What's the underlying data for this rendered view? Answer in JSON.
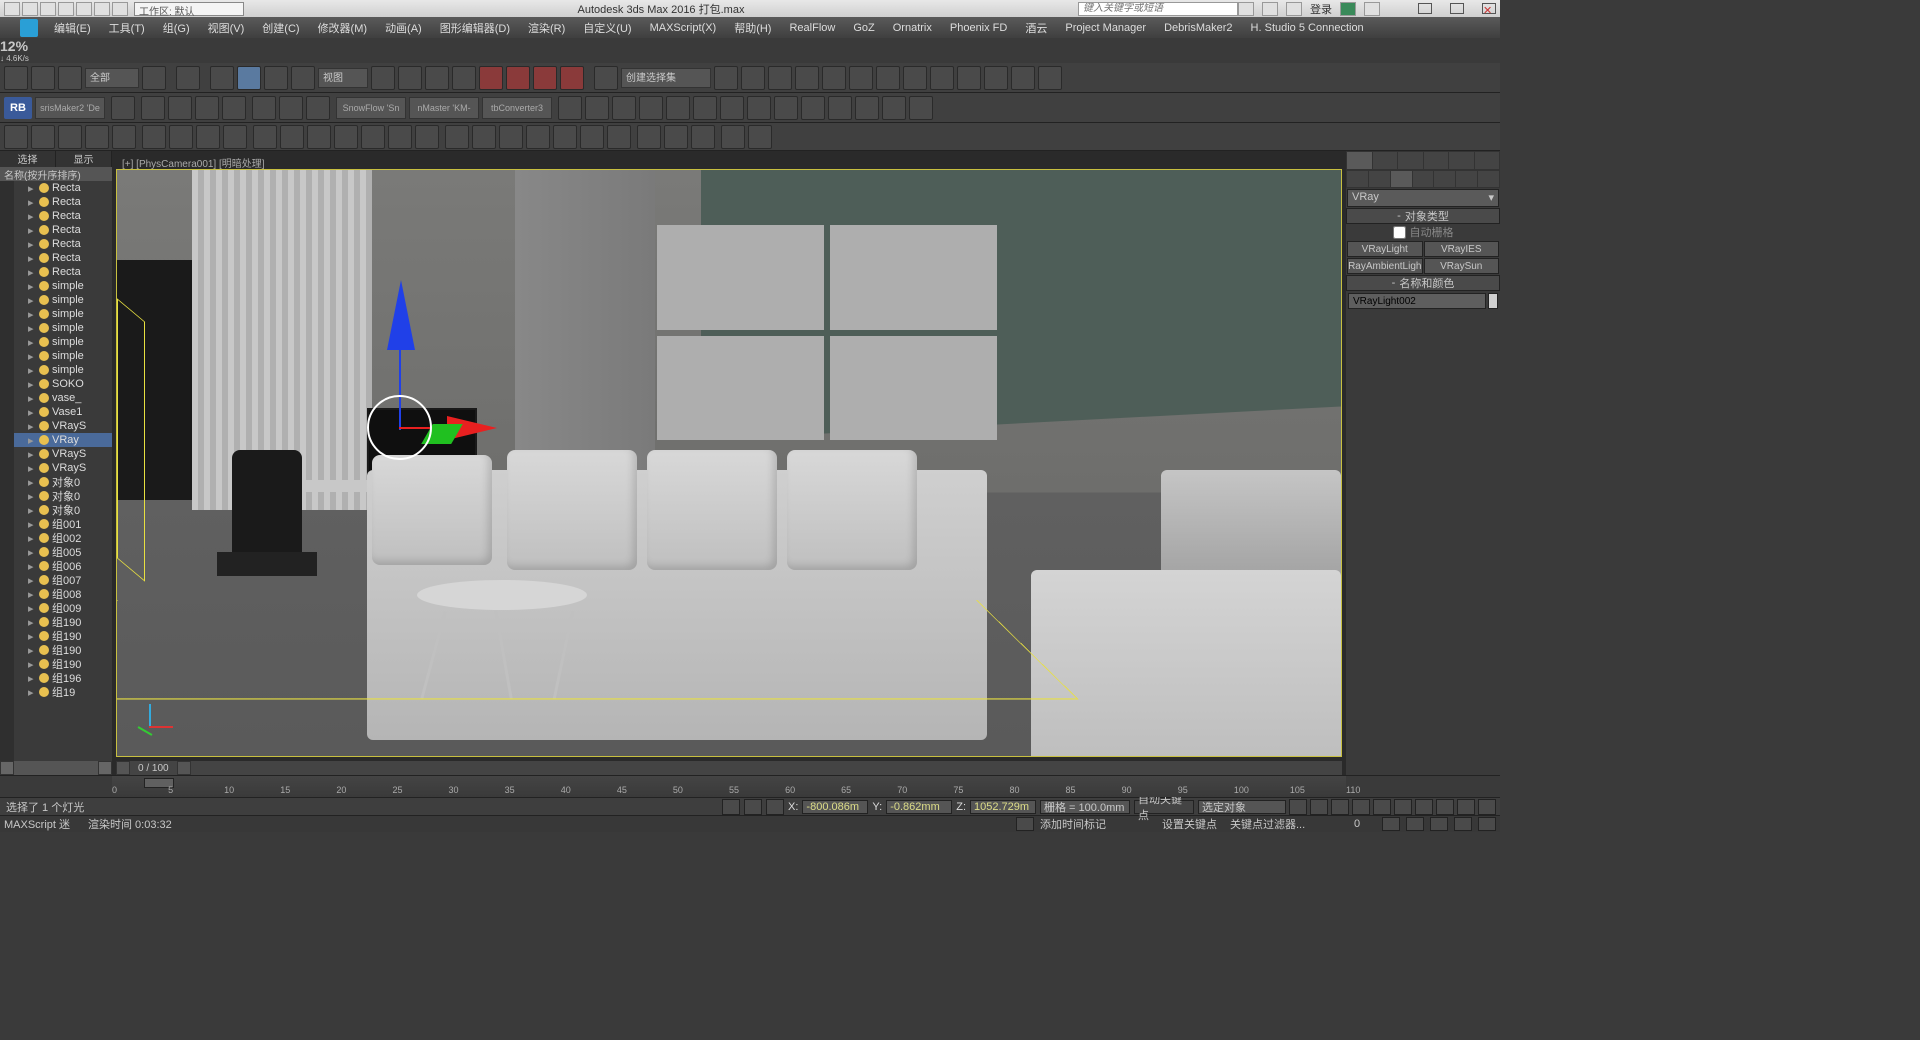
{
  "titlebar": {
    "workspace_label": "工作区: 默认",
    "app_title": "Autodesk 3ds Max 2016     打包.max",
    "search_placeholder": "键入关键字或短语",
    "login_label": "登录"
  },
  "speed_circle": {
    "percent": "12%",
    "rate": "↓ 4.6K/s"
  },
  "menu": {
    "items": [
      "编辑(E)",
      "工具(T)",
      "组(G)",
      "视图(V)",
      "创建(C)",
      "修改器(M)",
      "动画(A)",
      "图形编辑器(D)",
      "渲染(R)",
      "自定义(U)",
      "MAXScript(X)",
      "帮助(H)",
      "RealFlow",
      "GoZ",
      "Ornatrix",
      "Phoenix FD",
      "酒云",
      "Project Manager",
      "DebrisMaker2",
      "H. Studio 5 Connection"
    ]
  },
  "toolbar1": {
    "set_dropdown": "全部",
    "view_dropdown": "视图",
    "named_sel": "创建选择集"
  },
  "toolbar2": {
    "rb": "RB",
    "plugins": [
      "srisMaker2 'De",
      "SnowFlow 'Sn",
      "nMaster 'KM-",
      "tbConverter3"
    ]
  },
  "left_panel": {
    "tabs": [
      "选择",
      "显示"
    ],
    "sort": "名称(按升序排序)",
    "items": [
      {
        "label": "Recta",
        "sel": false
      },
      {
        "label": "Recta",
        "sel": false
      },
      {
        "label": "Recta",
        "sel": false
      },
      {
        "label": "Recta",
        "sel": false
      },
      {
        "label": "Recta",
        "sel": false
      },
      {
        "label": "Recta",
        "sel": false
      },
      {
        "label": "Recta",
        "sel": false
      },
      {
        "label": "simple",
        "sel": false
      },
      {
        "label": "simple",
        "sel": false
      },
      {
        "label": "simple",
        "sel": false
      },
      {
        "label": "simple",
        "sel": false
      },
      {
        "label": "simple",
        "sel": false
      },
      {
        "label": "simple",
        "sel": false
      },
      {
        "label": "simple",
        "sel": false
      },
      {
        "label": "SOKO",
        "sel": false
      },
      {
        "label": "vase_",
        "sel": false
      },
      {
        "label": "Vase1",
        "sel": false
      },
      {
        "label": "VRayS",
        "sel": false
      },
      {
        "label": "VRay",
        "sel": true
      },
      {
        "label": "VRayS",
        "sel": false
      },
      {
        "label": "VRayS",
        "sel": false
      },
      {
        "label": "对象0",
        "sel": false
      },
      {
        "label": "对象0",
        "sel": false
      },
      {
        "label": "对象0",
        "sel": false
      },
      {
        "label": "组001",
        "sel": false
      },
      {
        "label": "组002",
        "sel": false
      },
      {
        "label": "组005",
        "sel": false
      },
      {
        "label": "组006",
        "sel": false
      },
      {
        "label": "组007",
        "sel": false
      },
      {
        "label": "组008",
        "sel": false
      },
      {
        "label": "组009",
        "sel": false
      },
      {
        "label": "组190",
        "sel": false
      },
      {
        "label": "组190",
        "sel": false
      },
      {
        "label": "组190",
        "sel": false
      },
      {
        "label": "组190",
        "sel": false
      },
      {
        "label": "组196",
        "sel": false
      },
      {
        "label": "组19",
        "sel": false
      }
    ]
  },
  "viewport": {
    "label": "[+] [PhysCamera001] [明暗处理]",
    "frame_counter": "0 / 100"
  },
  "timeline": {
    "ticks": [
      0,
      5,
      10,
      15,
      20,
      25,
      30,
      35,
      40,
      45,
      50,
      55,
      60,
      65,
      70,
      75,
      80,
      85,
      90,
      95,
      100,
      105,
      110
    ]
  },
  "status": {
    "selection": "选择了 1 个灯光",
    "x_label": "X:",
    "x_val": "-800.086m",
    "y_label": "Y:",
    "y_val": "-0.862mm",
    "z_label": "Z:",
    "z_val": "1052.729m",
    "grid_label": "栅格 = 100.0mm",
    "autokey": "自动关键点",
    "selected_filter": "选定对象",
    "add_time_tag": "添加时间标记",
    "set_key": "设置关键点",
    "key_filter": "关键点过滤器..."
  },
  "status2": {
    "maxscript": "MAXScript  迷",
    "render_time_label": "渲染时间  0:03:32"
  },
  "right_panel": {
    "category": "VRay",
    "rollout1": "对象类型",
    "autogrid": "自动栅格",
    "buttons": [
      "VRayLight",
      "VRayIES",
      "RayAmbientLigh",
      "VRaySun"
    ],
    "rollout2": "名称和颜色",
    "obj_name": "VRayLight002"
  }
}
